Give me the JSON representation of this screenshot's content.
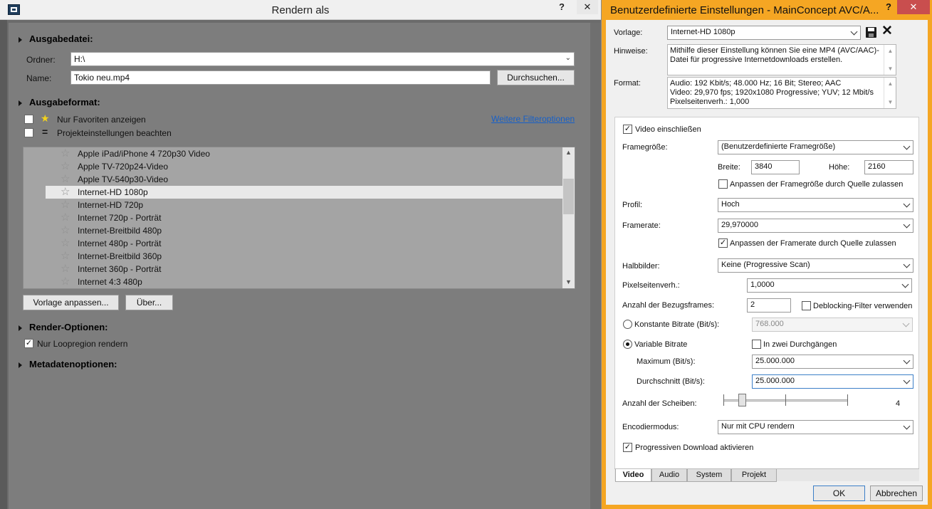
{
  "left_window": {
    "title": "Rendern als",
    "help": "?",
    "close": "✕",
    "sections": {
      "output_file": "Ausgabedatei:",
      "output_format": "Ausgabeformat:",
      "render_options": "Render-Optionen:",
      "metadata": "Metadatenoptionen:"
    },
    "folder_label": "Ordner:",
    "folder_value": "H:\\",
    "name_label": "Name:",
    "name_value": "Tokio neu.mp4",
    "browse_button": "Durchsuchen...",
    "favorites_label": "Nur Favoriten anzeigen",
    "project_settings_label": "Projekteinstellungen beachten",
    "more_filter_link": "Weitere Filteroptionen",
    "presets": [
      {
        "name": "Apple iPad/iPhone 4 720p30 Video",
        "selected": false
      },
      {
        "name": "Apple TV-720p24-Video",
        "selected": false
      },
      {
        "name": "Apple TV-540p30-Video",
        "selected": false
      },
      {
        "name": "Internet-HD 1080p",
        "selected": true
      },
      {
        "name": "Internet-HD 720p",
        "selected": false
      },
      {
        "name": "Internet 720p - Porträt",
        "selected": false
      },
      {
        "name": "Internet-Breitbild 480p",
        "selected": false
      },
      {
        "name": "Internet 480p - Porträt",
        "selected": false
      },
      {
        "name": "Internet-Breitbild 360p",
        "selected": false
      },
      {
        "name": "Internet 360p - Porträt",
        "selected": false
      },
      {
        "name": "Internet 4:3 480p",
        "selected": false
      }
    ],
    "customize_button": "Vorlage anpassen...",
    "about_button": "Über...",
    "loop_region_label": "Nur Loopregion rendern",
    "loop_region_checked": true
  },
  "right_window": {
    "title": "Benutzerdefinierte Einstellungen - MainConcept AVC/A...",
    "help": "?",
    "close": "✕",
    "template_label": "Vorlage:",
    "template_value": "Internet-HD 1080p",
    "notes_label": "Hinweise:",
    "notes_value": "Mithilfe dieser Einstellung können Sie eine MP4 (AVC/AAC)-Datei für progressive Internetdownloads erstellen.",
    "format_label": "Format:",
    "format_lines": [
      "Audio: 192 Kbit/s; 48.000 Hz; 16 Bit; Stereo; AAC",
      "Video: 29,970 fps; 1920x1080 Progressive; YUV; 12 Mbit/s",
      "Pixelseitenverh.: 1,000"
    ],
    "include_video_label": "Video einschließen",
    "framesize_label": "Framegröße:",
    "framesize_value": "(Benutzerdefinierte Framegröße)",
    "width_label": "Breite:",
    "width_value": "3840",
    "height_label": "Höhe:",
    "height_value": "2160",
    "allow_source_framesize_label": "Anpassen der Framegröße durch Quelle zulassen",
    "profile_label": "Profil:",
    "profile_value": "Hoch",
    "framerate_label": "Framerate:",
    "framerate_value": "29,970000",
    "allow_source_framerate_label": "Anpassen der Framerate durch Quelle zulassen",
    "fields_label": "Halbbilder:",
    "fields_value": "Keine (Progressive Scan)",
    "pixel_aspect_label": "Pixelseitenverh.:",
    "pixel_aspect_value": "1,0000",
    "ref_frames_label": "Anzahl der Bezugsframes:",
    "ref_frames_value": "2",
    "deblocking_label": "Deblocking-Filter verwenden",
    "constant_bitrate_label": "Konstante Bitrate (Bit/s):",
    "constant_bitrate_value": "768.000",
    "variable_bitrate_label": "Variable Bitrate",
    "two_pass_label": "In zwei Durchgängen",
    "maximum_label": "Maximum (Bit/s):",
    "maximum_value": "25.000.000",
    "average_label": "Durchschnitt (Bit/s):",
    "average_value": "25.000.000",
    "slices_label": "Anzahl der Scheiben:",
    "slices_value": "4",
    "slices_level": 0.15,
    "encode_mode_label": "Encodiermodus:",
    "encode_mode_value": "Nur mit CPU rendern",
    "progressive_download_label": "Progressiven Download aktivieren",
    "tabs": [
      "Video",
      "Audio",
      "System",
      "Projekt"
    ],
    "ok_button": "OK",
    "cancel_button": "Abbrechen"
  },
  "colors": {
    "accent_title_bar": "#f5a623",
    "selection_row": "#e9e9e9",
    "link_blue": "#1760c8",
    "close_red": "#c94e4e"
  }
}
